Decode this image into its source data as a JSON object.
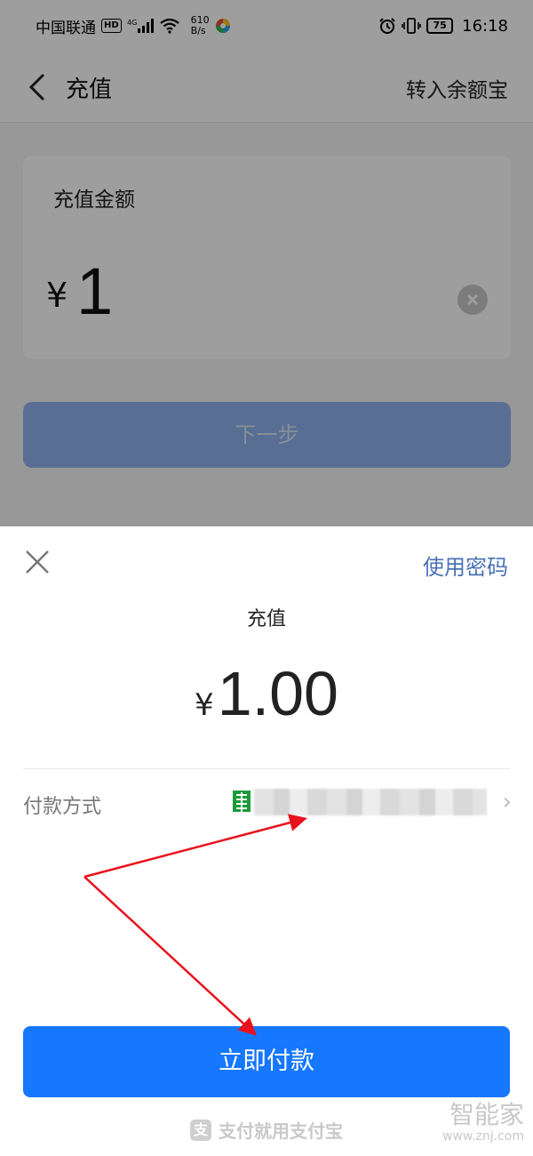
{
  "status_bar": {
    "carrier": "中国联通",
    "hd": "HD",
    "net_type": "4G",
    "net_speed_value": "610",
    "net_speed_unit": "B/s",
    "battery": "75",
    "time": "16:18"
  },
  "nav": {
    "title": "充值",
    "action": "转入余额宝"
  },
  "recharge": {
    "label": "充值金额",
    "currency": "¥",
    "amount": "1",
    "next_button": "下一步"
  },
  "payment_sheet": {
    "use_password": "使用密码",
    "title": "充值",
    "currency": "¥",
    "amount": "1.00",
    "method_label": "付款方式",
    "pay_button": "立即付款",
    "footer": "支付就用支付宝",
    "footer_icon": "支"
  },
  "watermark": {
    "text": "智能家",
    "url": "www.znj.com"
  },
  "colors": {
    "primary_blue": "#1677ff",
    "link_blue": "#4a71b5",
    "annotation_red": "#e8121c",
    "bank_green": "#1a9a3a"
  },
  "icons": {
    "back": "chevron-left-icon",
    "close": "close-icon",
    "clear": "clear-circle-icon",
    "bank": "bank-card-icon",
    "chevron": "chevron-right-icon",
    "alarm": "alarm-icon",
    "vibrate": "vibrate-icon",
    "wifi": "wifi-icon",
    "signal": "signal-icon"
  }
}
